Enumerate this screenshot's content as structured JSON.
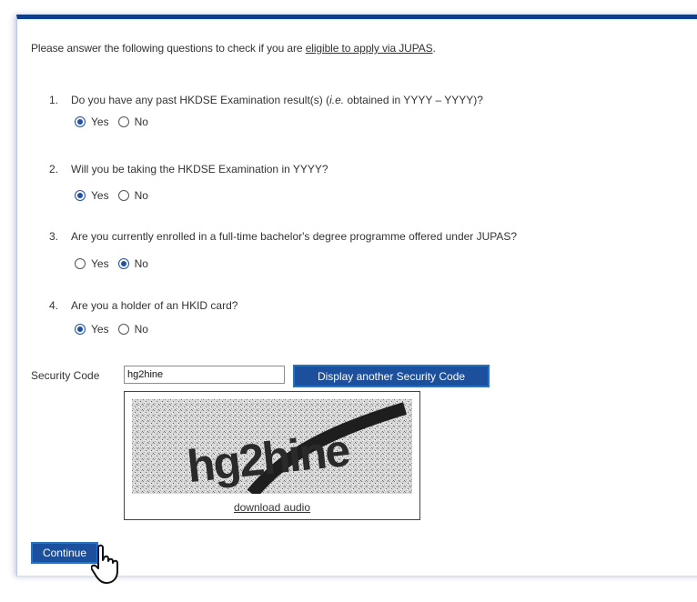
{
  "intro": {
    "text": "Please answer the following questions to check if you are ",
    "link": "eligible to apply via JUPAS",
    "end": "."
  },
  "questions": [
    {
      "num": "1.",
      "pre": "Do you have any past HKDSE Examination result(s) (",
      "italic": "i.e.",
      "post": " obtained in  YYYY – YYYY)?",
      "yes": "Yes",
      "no": "No",
      "selected": "yes"
    },
    {
      "num": "2.",
      "text": "Will you be taking the HKDSE Examination in YYYY?",
      "yes": "Yes",
      "no": "No",
      "selected": "yes"
    },
    {
      "num": "3.",
      "text": "Are you currently enrolled in a full-time bachelor's degree programme offered under JUPAS?",
      "yes": "Yes",
      "no": "No",
      "selected": "no"
    },
    {
      "num": "4.",
      "text": "Are you a holder of an HKID card?",
      "yes": "Yes",
      "no": "No",
      "selected": "yes"
    }
  ],
  "security": {
    "label": "Security Code",
    "value": "hg2hine",
    "refresh_label": "Display another Security Code",
    "captcha_text": "hg2hine",
    "audio_link": "download audio"
  },
  "continue_label": "Continue",
  "colors": {
    "accent": "#1c4f9c",
    "top_bar": "#0b3f93",
    "radio": "#1d4fb5"
  },
  "icons": {
    "cursor": "hand-pointer-icon"
  }
}
